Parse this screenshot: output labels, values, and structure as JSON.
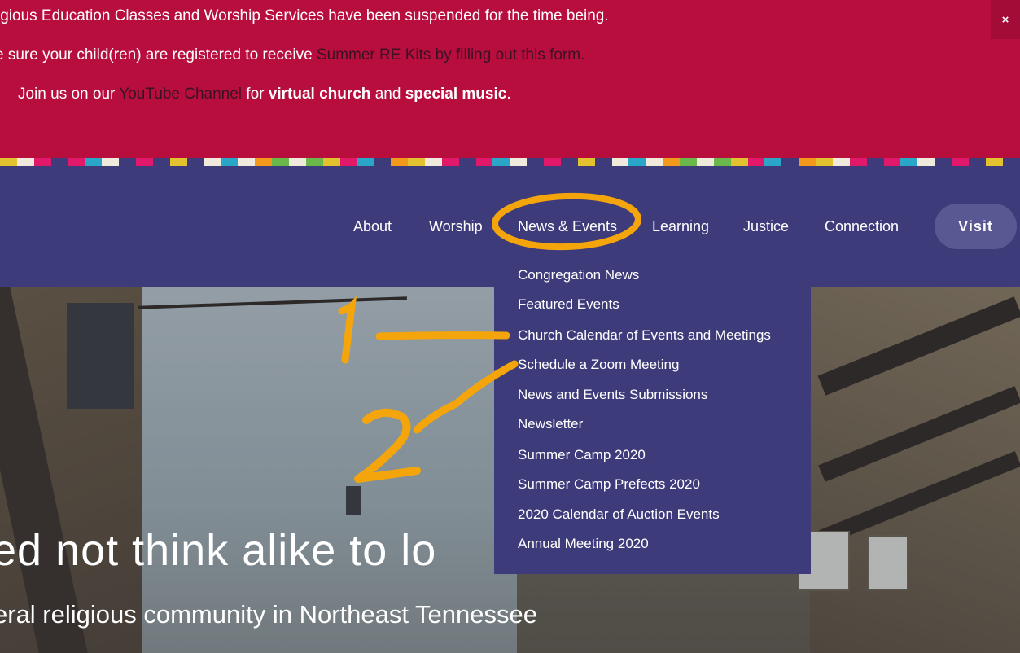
{
  "banner": {
    "line1": "igious Education Classes and Worship Services have been suspended for the time being.",
    "line2_pre": "e sure your child(ren) are registered to receive ",
    "line2_link": "Summer RE Kits",
    "line2_mid": " by ",
    "line2_link2": "filling out this form.",
    "line3_pre": "Join us on our ",
    "line3_link": "YouTube Channel",
    "line3_mid": " for ",
    "line3_b1": "virtual church",
    "line3_and": " and ",
    "line3_b2": "special music",
    "line3_end": ".",
    "close_label": "×"
  },
  "colors": {
    "banner_bg": "#b70e3e",
    "nav_bg": "#3e3b7a",
    "annotation": "#f5a50c",
    "stripe": [
      "#e4c22f",
      "#3e3b7a",
      "#f0eadd",
      "#2aa6c8",
      "#e2186a",
      "#3e3b7a",
      "#6bb84a",
      "#f0eadd",
      "#e2186a",
      "#f39a1d",
      "#3e3b7a",
      "#2aa6c8",
      "#f0eadd",
      "#e4c22f",
      "#e2186a",
      "#3e3b7a",
      "#6bb84a",
      "#f39a1d",
      "#f0eadd",
      "#2aa6c8",
      "#e2186a",
      "#3e3b7a",
      "#e4c22f",
      "#f0eadd"
    ]
  },
  "nav": {
    "items": [
      "About",
      "Worship",
      "News & Events",
      "Learning",
      "Justice",
      "Connection"
    ],
    "visit": "Visit"
  },
  "dropdown": {
    "items": [
      "Congregation News",
      "Featured Events",
      "Church Calendar of Events and Meetings",
      "Schedule a Zoom Meeting",
      "News and Events Submissions",
      "Newsletter",
      "Summer Camp 2020",
      "Summer Camp Prefects 2020",
      "2020 Calendar of Auction Events",
      "Annual Meeting 2020"
    ]
  },
  "hero": {
    "title": "ed not think alike to lo",
    "subtitle": "eral religious community in Northeast Tennessee"
  },
  "annotations": {
    "label1": "1",
    "label2": "2"
  }
}
